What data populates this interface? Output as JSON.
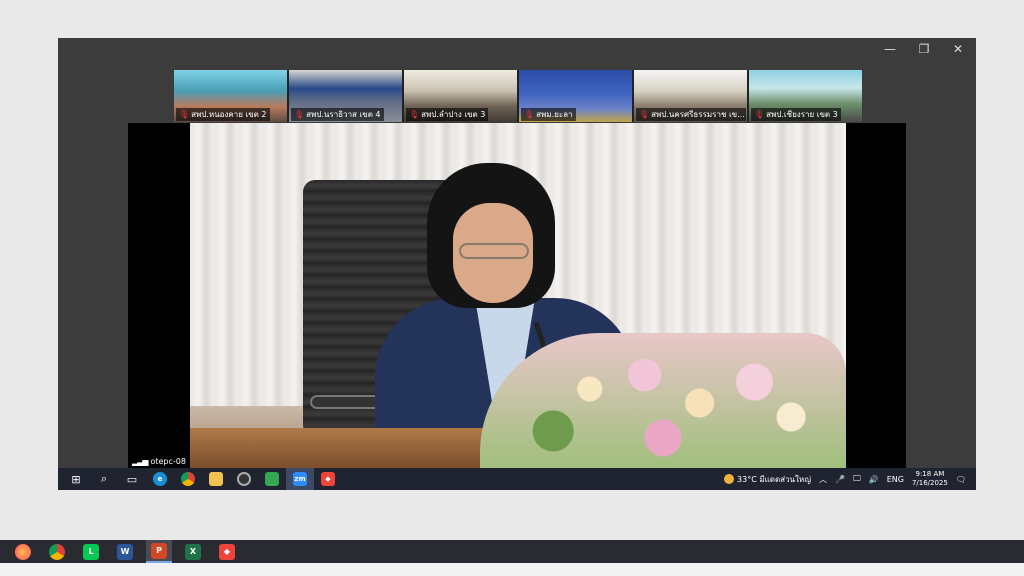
{
  "gallery": {
    "tiles": [
      {
        "label": "สพป.หนองคาย เขต 2"
      },
      {
        "label": "สพป.นราธิวาส เขต 4"
      },
      {
        "label": "สพป.ลำปาง เขต 3"
      },
      {
        "label": "สพม.ยะลา"
      },
      {
        "label": "สพป.นครศรีธรรมราช เข..."
      },
      {
        "label": "สพป.เชียงราย เขต 3"
      }
    ]
  },
  "main_video": {
    "participant_name": "otepc-08"
  },
  "inner_taskbar": {
    "weather": "33°C",
    "weather_desc": "มีแดดส่วนใหญ่",
    "language": "ENG",
    "time": "9:18 AM",
    "date": "7/16/2025",
    "apps": [
      "windows-start",
      "search",
      "task-view",
      "edge",
      "chrome",
      "file-explorer",
      "camera",
      "meet",
      "zoom",
      "anydesk"
    ]
  },
  "outer_taskbar": {
    "apps": [
      "firefox",
      "chrome",
      "line",
      "word",
      "powerpoint",
      "excel",
      "anydesk"
    ],
    "active": "powerpoint"
  },
  "colors": {
    "accent": "#7aa7e8",
    "taskbar_dark": "#1f2430"
  }
}
